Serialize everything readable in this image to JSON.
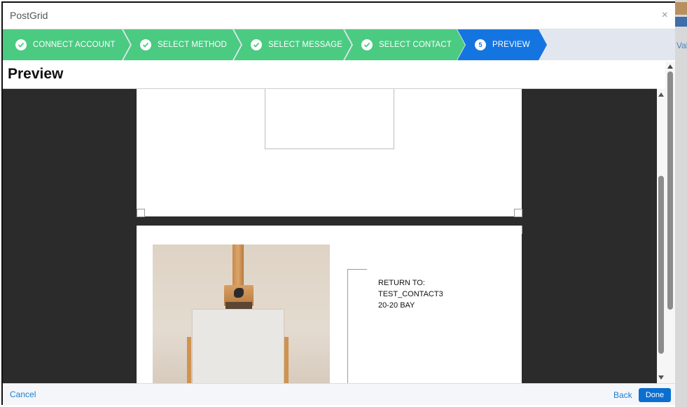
{
  "background_app": {
    "partial_text": "Vali"
  },
  "modal": {
    "title": "PostGrid",
    "close_symbol": "×"
  },
  "steps": [
    {
      "label": "CONNECT ACCOUNT",
      "state": "completed",
      "icon": "check-icon"
    },
    {
      "label": "SELECT METHOD",
      "state": "completed",
      "icon": "check-icon"
    },
    {
      "label": "SELECT MESSAGE",
      "state": "completed",
      "icon": "check-icon"
    },
    {
      "label": "SELECT CONTACT",
      "state": "completed",
      "icon": "check-icon"
    },
    {
      "label": "PREVIEW",
      "state": "active",
      "number": "5"
    }
  ],
  "section": {
    "title": "Preview"
  },
  "preview": {
    "return_address": {
      "heading": "RETURN TO:",
      "name": "TEST_CONTACT3",
      "line1": "20-20 BAY"
    }
  },
  "footer": {
    "cancel_label": "Cancel",
    "back_label": "Back",
    "done_label": "Done"
  },
  "colors": {
    "step_completed": "#4bca81",
    "step_active": "#1575e0",
    "link": "#1b7fd1",
    "primary_button": "#0b6fd0",
    "viewer_background": "#2b2b2b"
  }
}
